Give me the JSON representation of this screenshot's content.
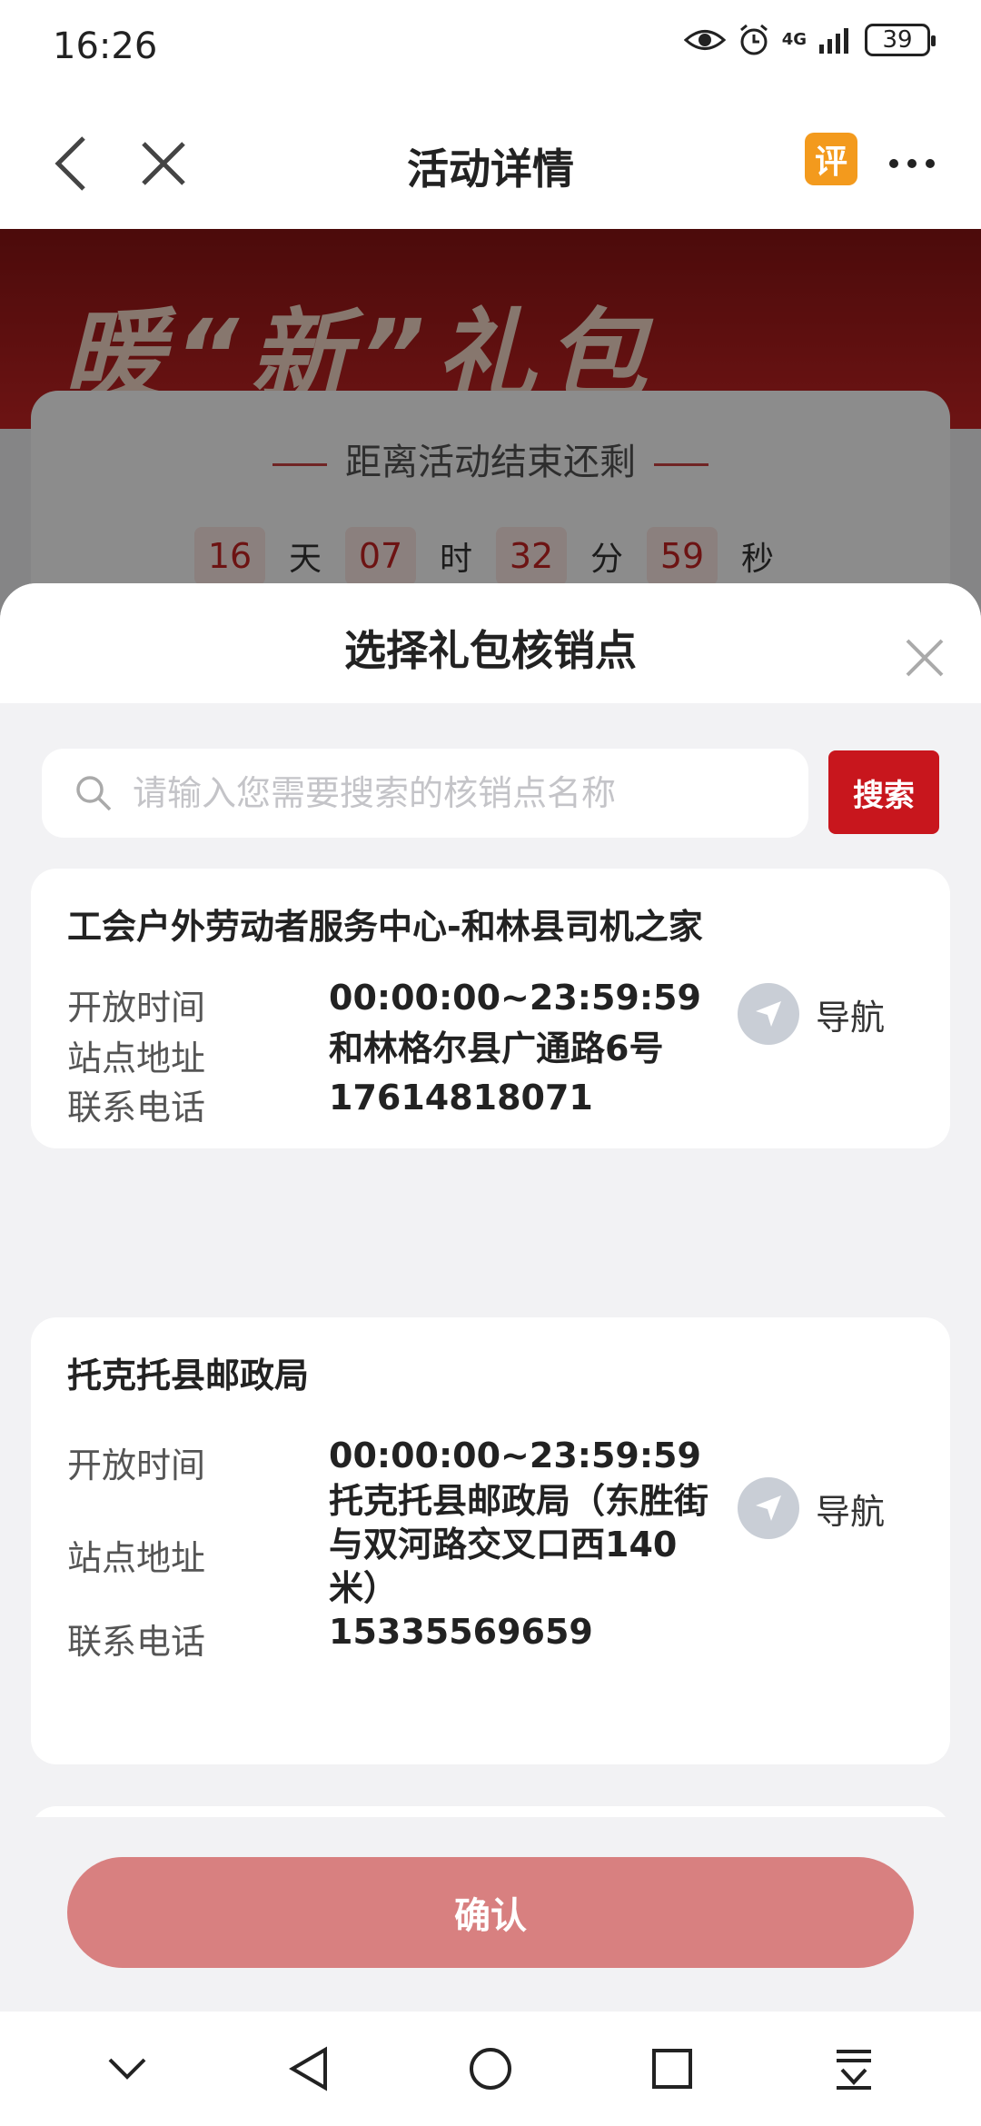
{
  "status_bar": {
    "time": "16:26",
    "network": "4G",
    "battery": "39"
  },
  "header": {
    "title": "活动详情",
    "review_badge": "评"
  },
  "background": {
    "banner_text": "暖“新”礼包",
    "countdown_label": "距离活动结束还剩",
    "countdown": [
      {
        "value": "16",
        "unit": "天"
      },
      {
        "value": "07",
        "unit": "时"
      },
      {
        "value": "32",
        "unit": "分"
      },
      {
        "value": "59",
        "unit": "秒"
      }
    ]
  },
  "sheet": {
    "title": "选择礼包核销点",
    "search_placeholder": "请输入您需要搜索的核销点名称",
    "search_value": "",
    "search_button": "搜索",
    "labels": {
      "hours": "开放时间",
      "address": "站点地址",
      "phone": "联系电话",
      "navigate": "导航"
    },
    "points": [
      {
        "name": "工会户外劳动者服务中心-和林县司机之家",
        "hours": "00:00:00~23:59:59",
        "address": "和林格尔县广通路6号",
        "phone": "17614818071"
      },
      {
        "name": "托克托县邮政局",
        "hours": "00:00:00~23:59:59",
        "address": "托克托县邮政局（东胜街与双河路交叉口西140米）",
        "phone": "15335569659"
      }
    ],
    "confirm_button": "确认"
  },
  "colors": {
    "accent": "#c8161d",
    "confirm_disabled": "#d88080",
    "nav_icon": "#c9ced6"
  }
}
